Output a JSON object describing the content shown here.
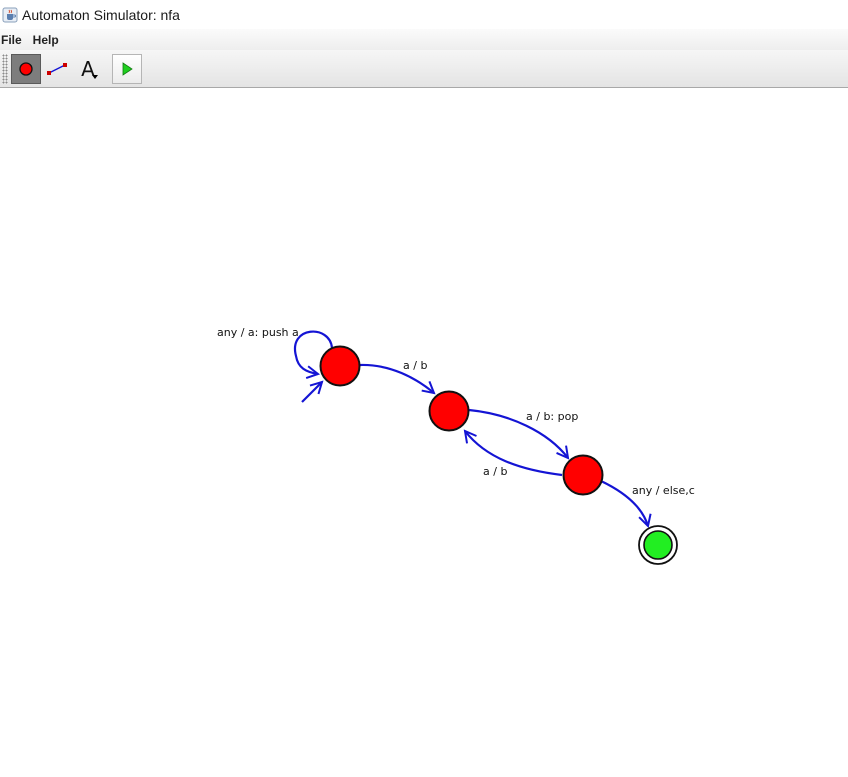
{
  "window": {
    "title": "Automaton Simulator: nfa",
    "icon": "java-cup-icon"
  },
  "menu": {
    "items": [
      {
        "label": "File"
      },
      {
        "label": "Help"
      }
    ]
  },
  "toolbar": {
    "tools": [
      {
        "name": "state-tool",
        "icon": "red-circle-icon",
        "selected": true
      },
      {
        "name": "transition-tool",
        "icon": "transition-line-icon",
        "selected": false
      },
      {
        "name": "text-tool",
        "icon": "letter-a-icon",
        "glyph": "A",
        "has_dropdown": true,
        "selected": false
      },
      {
        "name": "play",
        "icon": "play-triangle-icon",
        "selected": false
      }
    ]
  },
  "automaton": {
    "colors": {
      "state_fill": "#ff0000",
      "final_fill": "#22ee22",
      "edge": "#1414d4",
      "outline": "#111111"
    },
    "states": [
      {
        "id": "q0",
        "start": true,
        "accepting": false
      },
      {
        "id": "q1",
        "start": false,
        "accepting": false
      },
      {
        "id": "q2",
        "start": false,
        "accepting": false
      },
      {
        "id": "q3",
        "start": false,
        "accepting": true
      }
    ],
    "transitions": [
      {
        "from": "q0",
        "to": "q0",
        "label": "any / a: push a"
      },
      {
        "from": "q0",
        "to": "q1",
        "label": "a / b"
      },
      {
        "from": "q1",
        "to": "q2",
        "label": "a / b: pop"
      },
      {
        "from": "q2",
        "to": "q1",
        "label": "a / b"
      },
      {
        "from": "q2",
        "to": "q3",
        "label": "any / else,c"
      }
    ]
  }
}
